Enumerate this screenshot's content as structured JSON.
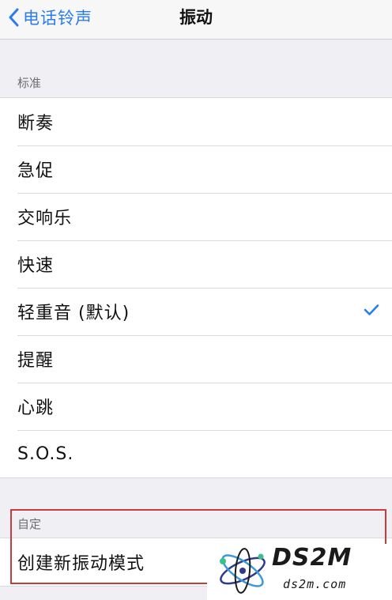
{
  "nav": {
    "back_label": "电话铃声",
    "title": "振动"
  },
  "standard": {
    "header": "标准",
    "items": [
      {
        "label": "断奏"
      },
      {
        "label": "急促"
      },
      {
        "label": "交响乐"
      },
      {
        "label": "快速"
      },
      {
        "label": "轻重音 (默认)"
      },
      {
        "label": "提醒"
      },
      {
        "label": "心跳"
      },
      {
        "label": "S.O.S."
      }
    ],
    "selected_index": 4
  },
  "custom": {
    "header": "自定",
    "items": [
      {
        "label": "创建新振动模式"
      }
    ]
  },
  "watermark": {
    "brand": "DS2M",
    "site": "ds2m.com"
  },
  "colors": {
    "accent": "#2b7cf0",
    "highlight": "#c83c3c",
    "background": "#efeff4"
  },
  "icons": {
    "back": "chevron-left-icon",
    "selected": "checkmark-icon"
  }
}
